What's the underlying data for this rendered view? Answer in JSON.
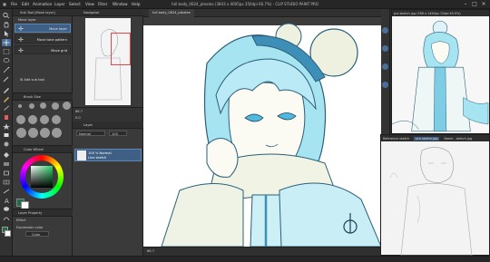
{
  "window": {
    "title": "full body_0624_ptealee (3843 x 4005px 350dpi 66.7%) - CLIP STUDIO PAINT PRO"
  },
  "menu": [
    "File",
    "Edit",
    "Animation",
    "Layer",
    "Select",
    "View",
    "Filter",
    "Window",
    "Help"
  ],
  "subtool": {
    "tab_label": "Sub Tool [Move layer]",
    "current_label": "Move layer",
    "items": [
      {
        "label": "Move layer",
        "selected": true
      },
      {
        "label": "Move tone pattern",
        "selected": false
      },
      {
        "label": "Move grid",
        "selected": false
      }
    ],
    "add_label": "Add sub tool"
  },
  "brush": {
    "tab_label": "Brush Size"
  },
  "color": {
    "tab_label": "Color Wheel",
    "main_color": "#1f6b4a",
    "sub_color": "#ffffff"
  },
  "expression": {
    "tab_label": "Layer Property",
    "effect_label": "Effect",
    "color_label": "Expression color",
    "color_value": "Color"
  },
  "navigator": {
    "tab_label": "Navigator",
    "zoom": "66.7",
    "angle": "0.0"
  },
  "layer": {
    "tab_label": "Layer",
    "blend_mode": "Normal",
    "opacity": "100",
    "rows": [
      {
        "name": "100 % Normal",
        "sub": "Line sketch",
        "selected": true
      }
    ]
  },
  "canvas": {
    "tab_label": "full body_0624_ptealee",
    "zoom_value": "66.7",
    "accent": "#8fd3ea",
    "line": "#2b5f78"
  },
  "references": {
    "top_title": "pre sketch.jpg (786 x 1450px 72dpi 65.9%)",
    "bottom_tabs": [
      "Reference sketch",
      "pre sketch.jpg",
      "Name - sketch.jpg"
    ]
  }
}
